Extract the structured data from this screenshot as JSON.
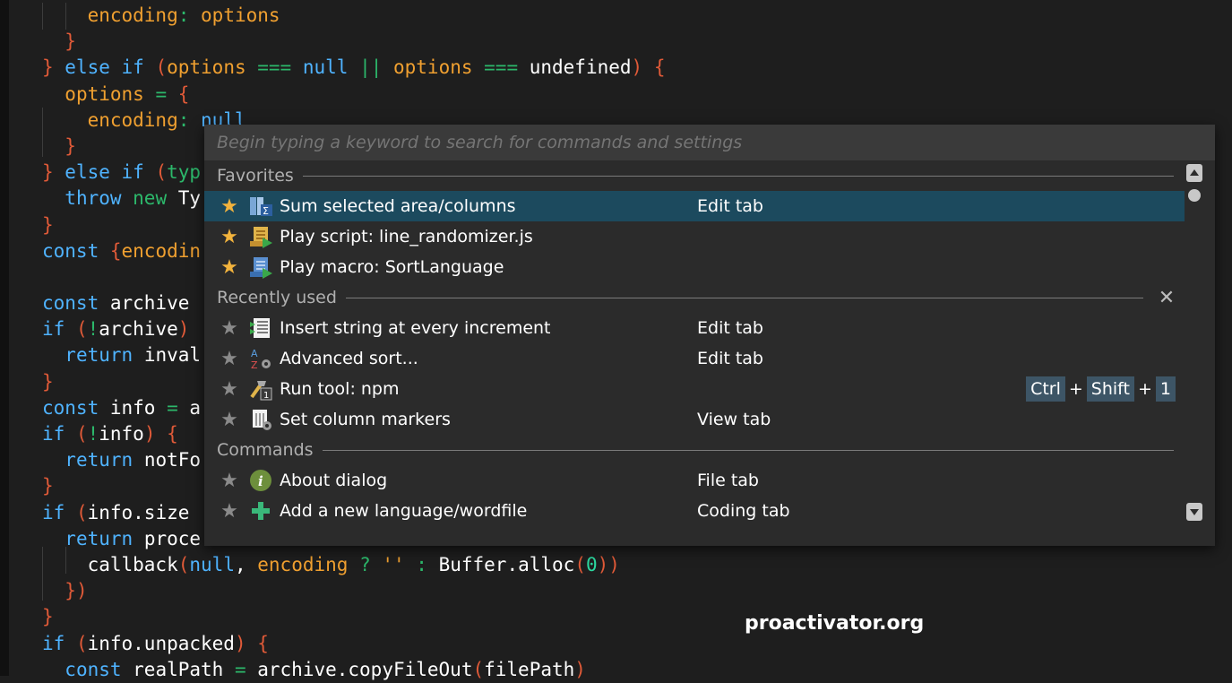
{
  "code_lines": [
    [
      {
        "t": "    ",
        "c": "plain"
      },
      {
        "t": "encoding",
        "c": "var"
      },
      {
        "t": ": ",
        "c": "op"
      },
      {
        "t": "options",
        "c": "var"
      }
    ],
    [
      {
        "t": "  ",
        "c": "plain"
      },
      {
        "t": "}",
        "c": "brace"
      }
    ],
    [
      {
        "t": "} ",
        "c": "brace"
      },
      {
        "t": "else if ",
        "c": "kw"
      },
      {
        "t": "(",
        "c": "brace"
      },
      {
        "t": "options ",
        "c": "var"
      },
      {
        "t": "=== ",
        "c": "op"
      },
      {
        "t": "null ",
        "c": "kw"
      },
      {
        "t": "|| ",
        "c": "op"
      },
      {
        "t": "options ",
        "c": "var"
      },
      {
        "t": "=== ",
        "c": "op"
      },
      {
        "t": "undefined",
        "c": "plain"
      },
      {
        "t": ") {",
        "c": "brace"
      }
    ],
    [
      {
        "t": "  ",
        "c": "plain"
      },
      {
        "t": "options ",
        "c": "var"
      },
      {
        "t": "= ",
        "c": "op"
      },
      {
        "t": "{",
        "c": "brace"
      }
    ],
    [
      {
        "t": "    ",
        "c": "plain"
      },
      {
        "t": "encoding",
        "c": "var"
      },
      {
        "t": ": ",
        "c": "op"
      },
      {
        "t": "null",
        "c": "kw"
      }
    ],
    [
      {
        "t": "  ",
        "c": "plain"
      },
      {
        "t": "}",
        "c": "brace"
      }
    ],
    [
      {
        "t": "} ",
        "c": "brace"
      },
      {
        "t": "else if ",
        "c": "kw"
      },
      {
        "t": "(",
        "c": "brace"
      },
      {
        "t": "typ",
        "c": "op"
      }
    ],
    [
      {
        "t": "  ",
        "c": "plain"
      },
      {
        "t": "throw ",
        "c": "kw"
      },
      {
        "t": "new ",
        "c": "op"
      },
      {
        "t": "Ty",
        "c": "plain"
      }
    ],
    [
      {
        "t": "}",
        "c": "brace"
      }
    ],
    [
      {
        "t": "const ",
        "c": "kw"
      },
      {
        "t": "{",
        "c": "brace"
      },
      {
        "t": "encodin",
        "c": "var"
      }
    ],
    [
      {
        "t": "",
        "c": "plain"
      }
    ],
    [
      {
        "t": "const ",
        "c": "kw"
      },
      {
        "t": "archive",
        "c": "plain"
      }
    ],
    [
      {
        "t": "if ",
        "c": "kw"
      },
      {
        "t": "(",
        "c": "brace"
      },
      {
        "t": "!",
        "c": "op"
      },
      {
        "t": "archive",
        "c": "plain"
      },
      {
        "t": ")",
        "c": "brace"
      }
    ],
    [
      {
        "t": "  ",
        "c": "plain"
      },
      {
        "t": "return ",
        "c": "kw"
      },
      {
        "t": "inval",
        "c": "plain"
      }
    ],
    [
      {
        "t": "}",
        "c": "brace"
      }
    ],
    [
      {
        "t": "const ",
        "c": "kw"
      },
      {
        "t": "info ",
        "c": "plain"
      },
      {
        "t": "= ",
        "c": "op"
      },
      {
        "t": "a",
        "c": "plain"
      }
    ],
    [
      {
        "t": "if ",
        "c": "kw"
      },
      {
        "t": "(",
        "c": "brace"
      },
      {
        "t": "!",
        "c": "op"
      },
      {
        "t": "info",
        "c": "plain"
      },
      {
        "t": ") {",
        "c": "brace"
      }
    ],
    [
      {
        "t": "  ",
        "c": "plain"
      },
      {
        "t": "return ",
        "c": "kw"
      },
      {
        "t": "notFo",
        "c": "plain"
      }
    ],
    [
      {
        "t": "}",
        "c": "brace"
      }
    ],
    [
      {
        "t": "if ",
        "c": "kw"
      },
      {
        "t": "(",
        "c": "brace"
      },
      {
        "t": "info.size",
        "c": "plain"
      }
    ],
    [
      {
        "t": "  ",
        "c": "plain"
      },
      {
        "t": "return ",
        "c": "kw"
      },
      {
        "t": "proce",
        "c": "plain"
      }
    ],
    [
      {
        "t": "    ",
        "c": "plain"
      },
      {
        "t": "callback",
        "c": "plain"
      },
      {
        "t": "(",
        "c": "brace"
      },
      {
        "t": "null",
        "c": "kw"
      },
      {
        "t": ", ",
        "c": "plain"
      },
      {
        "t": "encoding ",
        "c": "var"
      },
      {
        "t": "? ",
        "c": "op"
      },
      {
        "t": "'' ",
        "c": "str"
      },
      {
        "t": ": ",
        "c": "op"
      },
      {
        "t": "Buffer.alloc",
        "c": "plain"
      },
      {
        "t": "(",
        "c": "brace"
      },
      {
        "t": "0",
        "c": "num"
      },
      {
        "t": "))",
        "c": "brace"
      }
    ],
    [
      {
        "t": "  ",
        "c": "plain"
      },
      {
        "t": "})",
        "c": "brace"
      }
    ],
    [
      {
        "t": "}",
        "c": "brace"
      }
    ],
    [
      {
        "t": "if ",
        "c": "kw"
      },
      {
        "t": "(",
        "c": "brace"
      },
      {
        "t": "info.unpacked",
        "c": "plain"
      },
      {
        "t": ") {",
        "c": "brace"
      }
    ],
    [
      {
        "t": "  ",
        "c": "plain"
      },
      {
        "t": "const ",
        "c": "kw"
      },
      {
        "t": "realPath ",
        "c": "plain"
      },
      {
        "t": "= ",
        "c": "op"
      },
      {
        "t": "archive.copyFileOut",
        "c": "plain"
      },
      {
        "t": "(",
        "c": "brace"
      },
      {
        "t": "filePath",
        "c": "plain"
      },
      {
        "t": ")",
        "c": "brace"
      }
    ]
  ],
  "palette": {
    "search_placeholder": "Begin typing a keyword to search for commands and settings",
    "sections": [
      {
        "title": "Favorites",
        "closable": false,
        "items": [
          {
            "label": "Sum selected area/columns",
            "tab": "Edit tab",
            "favorite": true,
            "icon": "sum-columns-icon",
            "selected": true
          },
          {
            "label": "Play script: line_randomizer.js",
            "tab": "",
            "favorite": true,
            "icon": "script-icon"
          },
          {
            "label": "Play macro: SortLanguage",
            "tab": "",
            "favorite": true,
            "icon": "macro-icon"
          }
        ]
      },
      {
        "title": "Recently used",
        "closable": true,
        "items": [
          {
            "label": "Insert string at every increment",
            "tab": "Edit tab",
            "favorite": false,
            "icon": "insert-string-icon"
          },
          {
            "label": "Advanced sort...",
            "tab": "Edit tab",
            "favorite": false,
            "icon": "sort-az-icon"
          },
          {
            "label": "Run tool: npm",
            "tab": "",
            "favorite": false,
            "icon": "tool-icon",
            "shortcut": [
              "Ctrl",
              "Shift",
              "1"
            ]
          },
          {
            "label": "Set column markers",
            "tab": "View tab",
            "favorite": false,
            "icon": "column-markers-icon"
          }
        ]
      },
      {
        "title": "Commands",
        "closable": false,
        "items": [
          {
            "label": "About dialog",
            "tab": "File tab",
            "favorite": false,
            "icon": "info-icon"
          },
          {
            "label": "Add a new language/wordfile",
            "tab": "Coding tab",
            "favorite": false,
            "icon": "plus-icon"
          }
        ]
      }
    ],
    "scrollbar": {
      "position": 0
    }
  },
  "watermark": "proactivator.org",
  "colors": {
    "accent_selected": "#1c4a5e",
    "star_favorite": "#f2b33d",
    "star_default": "#8a8a8a"
  }
}
